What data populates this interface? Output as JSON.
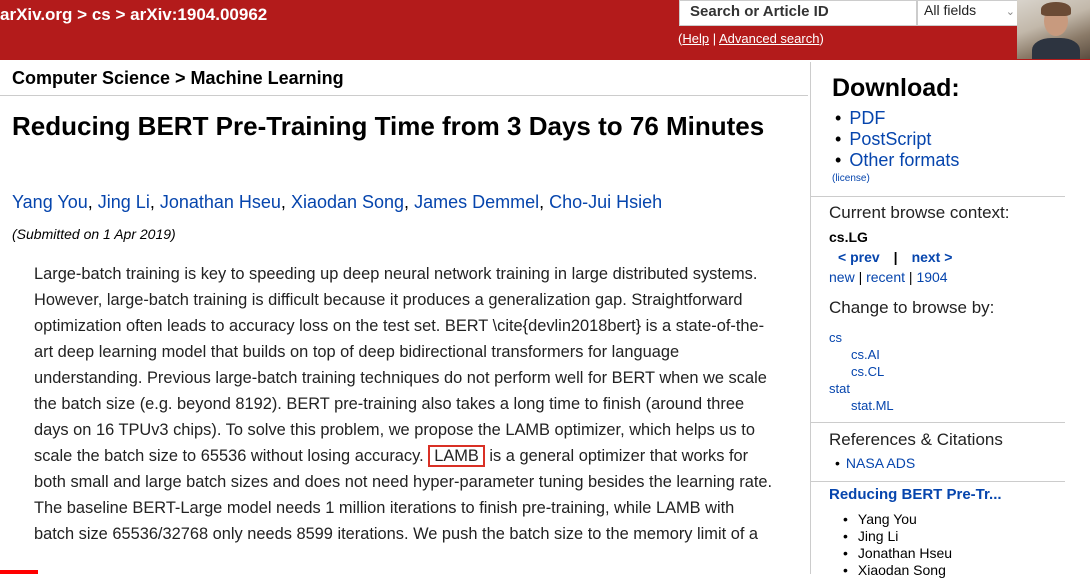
{
  "header": {
    "breadcrumbs": [
      "arXiv.org",
      "cs",
      "arXiv:1904.00962"
    ],
    "separator": ">",
    "search_placeholder": "Search or Article ID",
    "field_select": "All fields",
    "help_open": "(",
    "help_label": "Help",
    "help_sep": " | ",
    "advanced_label": "Advanced search",
    "help_close": ")"
  },
  "colors": {
    "header": "#b31b1b",
    "link": "#0645ad",
    "highlight": "#d93025"
  },
  "main": {
    "subject": "Computer Science > Machine Learning",
    "title": "Reducing BERT Pre-Training Time from 3 Days to 76 Minutes",
    "authors": [
      "Yang You",
      "Jing Li",
      "Jonathan Hseu",
      "Xiaodan Song",
      "James Demmel",
      "Cho-Jui Hsieh"
    ],
    "submitted": "(Submitted on 1 Apr 2019)",
    "abstract_before": "Large-batch training is key to speeding up deep neural network training in large distributed systems. However, large-batch training is difficult because it produces a generalization gap. Straightforward optimization often leads to accuracy loss on the test set. BERT \\cite{devlin2018bert} is a state-of-the-art deep learning model that builds on top of deep bidirectional transformers for language understanding. Previous large-batch training techniques do not perform well for BERT when we scale the batch size (e.g. beyond 8192). BERT pre-training also takes a long time to finish (around three days on 16 TPUv3 chips). To solve this problem, we propose the LAMB optimizer, which helps us to scale the batch size to 65536 without losing accuracy.",
    "abstract_highlight": "LAMB",
    "abstract_after": " is a general optimizer that works for both small and large batch sizes and does not need hyper-parameter tuning besides the learning rate. The baseline BERT-Large model needs 1 million iterations to finish pre-training, while LAMB with batch size 65536/32768 only needs 8599 iterations. We push the batch size to the memory limit of a"
  },
  "sidebar": {
    "download_title": "Download:",
    "downloads": [
      "PDF",
      "PostScript",
      "Other formats"
    ],
    "license": "(license)",
    "context_title": "Current browse context:",
    "context_category": "cs.LG",
    "prev": "< prev",
    "nav_bar": "|",
    "next": "next >",
    "new": "new",
    "recent": "recent",
    "year": "1904",
    "pipe": " | ",
    "change_title": "Change to browse by:",
    "browse": [
      {
        "label": "cs",
        "indent": false
      },
      {
        "label": "cs.AI",
        "indent": true
      },
      {
        "label": "cs.CL",
        "indent": true
      },
      {
        "label": "stat",
        "indent": false
      },
      {
        "label": "stat.ML",
        "indent": true
      }
    ],
    "refs_title": "References & Citations",
    "refs_item": "NASA ADS",
    "bookmark_title": "Reducing BERT Pre-Tr...",
    "bookmark_authors": [
      "Yang You",
      "Jing Li",
      "Jonathan Hseu",
      "Xiaodan Song"
    ],
    "bullet": "•"
  }
}
